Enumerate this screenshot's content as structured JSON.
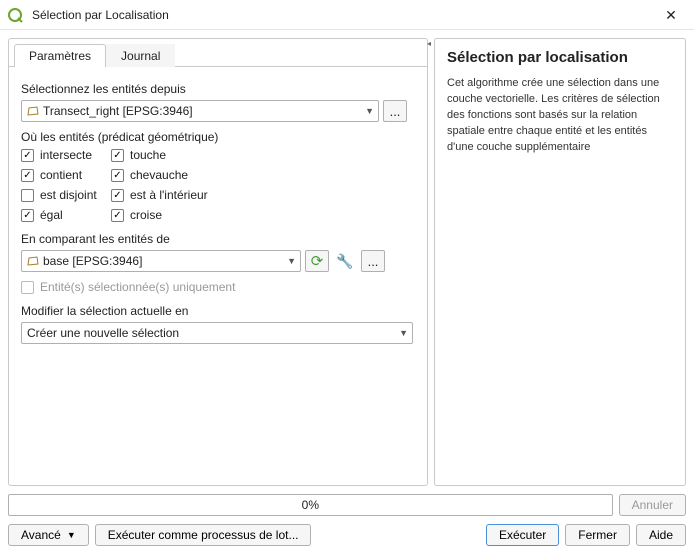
{
  "window": {
    "title": "Sélection par Localisation",
    "close_symbol": "✕"
  },
  "tabs": {
    "parameters": "Paramètres",
    "log": "Journal"
  },
  "labels": {
    "select_from": "Sélectionnez les entités depuis",
    "predicate_group": "Où les entités (prédicat géométrique)",
    "intersects": "intersecte",
    "touches": "touche",
    "contains": "contient",
    "overlaps": "chevauche",
    "disjoint": "est disjoint",
    "within": "est à l'intérieur",
    "equals": "égal",
    "crosses": "croise",
    "comparing": "En comparant les entités de",
    "selected_only": "Entité(s) sélectionnée(s) uniquement",
    "modify_selection": "Modifier la sélection actuelle en",
    "browse": "...",
    "progress": "0%"
  },
  "dropdowns": {
    "layer1": "Transect_right [EPSG:3946]",
    "layer2": "base [EPSG:3946]",
    "mode": "Créer une nouvelle sélection"
  },
  "help": {
    "title": "Sélection par localisation",
    "body": "Cet algorithme crée une sélection dans une couche vectorielle. Les critères de sélection des fonctions sont basés sur la relation spatiale entre chaque entité et les entités d'une couche supplémentaire"
  },
  "buttons": {
    "cancel": "Annuler",
    "advanced": "Avancé",
    "batch": "Exécuter comme processus de lot...",
    "run": "Exécuter",
    "close": "Fermer",
    "help_btn": "Aide"
  }
}
